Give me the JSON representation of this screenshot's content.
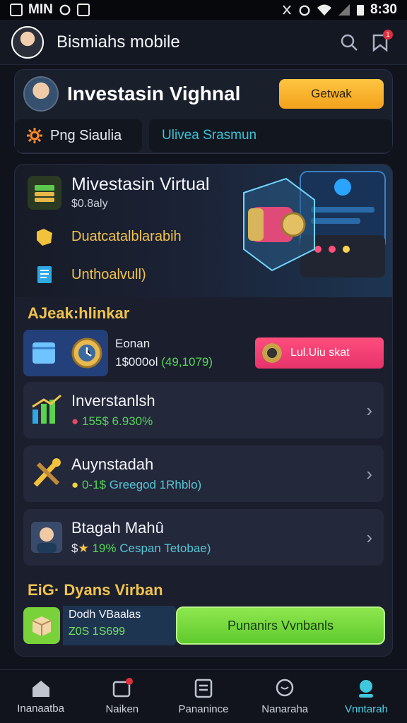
{
  "status_bar": {
    "left": "MIN",
    "time": "8:30"
  },
  "app_bar": {
    "title": "Bismiahs mobile",
    "notification_count": "1"
  },
  "hero": {
    "title": "Investasin Vighnal",
    "button": "Getwak",
    "left_chip": "Png Siaulia",
    "right_chip": "Ulivea Srasmun"
  },
  "banner": {
    "title": "Mivestasin Virtual",
    "subtitle": "$0.8aly",
    "line2": "Duatcatalblarabih",
    "line3": "Unthoalvull)"
  },
  "section1": {
    "title": "AJeak:hlinkar"
  },
  "feature": {
    "label": "Eonan",
    "value_main": "1$000ol",
    "value_green": "(49,1079)",
    "button": "Lul.Uiu skat"
  },
  "list": [
    {
      "title": "Inverstanlsh",
      "sub_prefix": "",
      "sub_green": "155$ 6.930%",
      "sub_rest": ""
    },
    {
      "title": "Auynstadah",
      "sub_prefix": "",
      "sub_green": "0-1$",
      "sub_rest": "Greegod 1Rhblo)"
    },
    {
      "title": "Btagah Mahû",
      "sub_prefix": "$",
      "sub_green": "19%",
      "sub_rest": "Cespan Tetobae)"
    }
  ],
  "section2": {
    "title": "EiG·  Dyans Virban"
  },
  "promo": {
    "line1": "Dodh VBaalas",
    "line2": "Z0S 1S699",
    "button": "Punanirs Vvnbanls"
  },
  "nav": [
    {
      "label": "Inanaatba"
    },
    {
      "label": "Naiken"
    },
    {
      "label": "Pananince"
    },
    {
      "label": "Nanaraha"
    },
    {
      "label": "Vnntarah"
    }
  ],
  "colors": {
    "accent_cyan": "#4ed2e6",
    "accent_yellow": "#f3c44a",
    "accent_green": "#5fca2d",
    "accent_pink": "#e6336a"
  }
}
